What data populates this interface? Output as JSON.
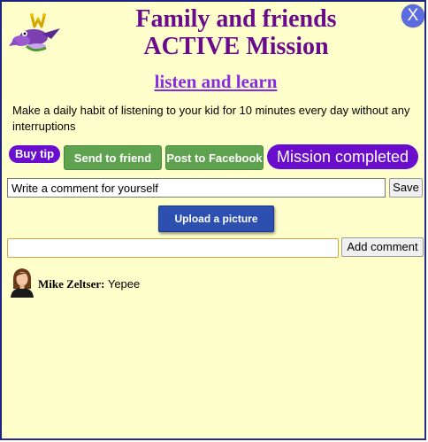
{
  "header": {
    "title_line1": "Family and friends",
    "title_line2": "ACTIVE Mission",
    "close_label": "X"
  },
  "mission": {
    "name": "listen and learn",
    "description": "Make a daily habit of listening to your kid for 10 minutes every day without any interruptions"
  },
  "actions": {
    "buy_tip": "Buy tip",
    "send_to_friend": "Send to friend",
    "post_to_facebook": "Post to Facebook",
    "mission_completed": "Mission completed"
  },
  "self_comment": {
    "value": "Write a comment for yourself",
    "save_label": "Save"
  },
  "upload": {
    "label": "Upload a picture"
  },
  "comment_box": {
    "value": "",
    "add_label": "Add comment"
  },
  "comments": [
    {
      "author": "Mike Zeltser:",
      "text": "Yepee",
      "avatar_icon": "user-avatar-icon"
    }
  ],
  "icons": {
    "logo": "family-logo-icon",
    "close": "close-icon"
  },
  "colors": {
    "background": "#ffffcc",
    "title": "#6b0a8a",
    "accent_purple": "#6a0dcc",
    "link": "#8a2be2",
    "green_button": "#5fa350",
    "upload_button": "#2d4fb0",
    "close_button": "#5b6be0"
  }
}
